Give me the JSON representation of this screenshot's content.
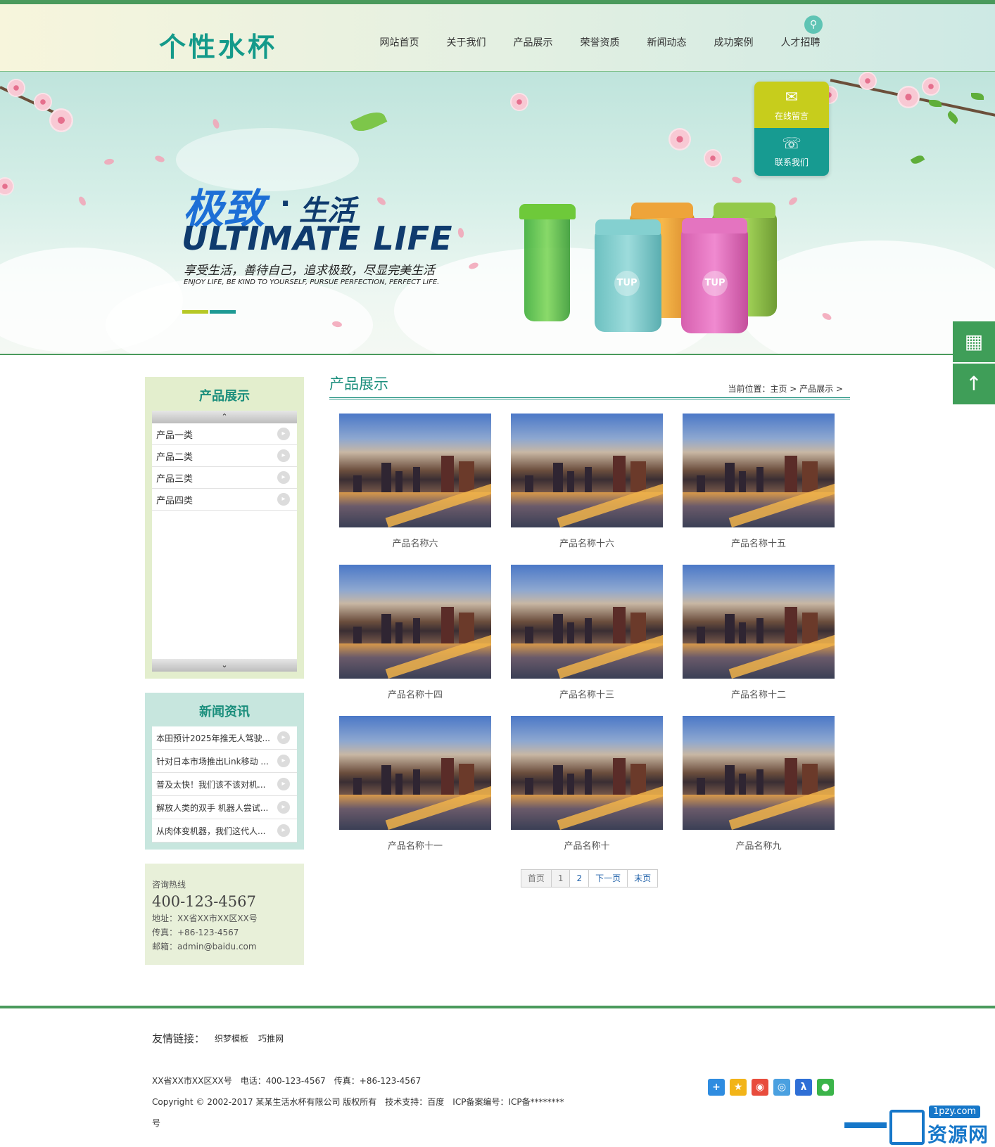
{
  "header": {
    "logo": "个性水杯",
    "nav": [
      "网站首页",
      "关于我们",
      "产品展示",
      "荣誉资质",
      "新闻动态",
      "成功案例",
      "人才招聘"
    ],
    "search_icon": "search-icon"
  },
  "banner": {
    "title_cn_1": "极致",
    "title_dot": "·",
    "title_cn_2": "生活",
    "title_en": "ULTIMATE  LIFE",
    "subtitle_cn": "享受生活，善待自己，追求极致，尽显完美生活",
    "subtitle_en": "ENJOY LIFE, BE KIND TO YOURSELF, PURSUE PERFECTION, PERFECT LIFE.",
    "cup_brand": "TUP"
  },
  "float_card": {
    "message_label": "在线留言",
    "contact_label": "联系我们"
  },
  "side_tools": {
    "qr_icon": "qr-code-icon",
    "top_icon": "back-to-top-icon"
  },
  "sidebar": {
    "product_title": "产品展示",
    "categories": [
      "产品一类",
      "产品二类",
      "产品三类",
      "产品四类"
    ],
    "news_title": "新闻资讯",
    "news": [
      "本田预计2025年推无人驾驶...",
      "针对日本市场推出Link移动 ...",
      "普及太快！我们该不该对机...",
      "解放人类的双手 机器人尝试...",
      "从肉体变机器，我们这代人..."
    ],
    "contact": {
      "hotline_label": "咨询热线",
      "hotline": "400-123-4567",
      "address": "地址：XX省XX市XX区XX号",
      "fax": "传真：+86-123-4567",
      "email": "邮箱：admin@baidu.com"
    }
  },
  "main": {
    "title": "产品展示",
    "breadcrumb": "当前位置：主页 > 产品展示 >",
    "products": [
      "产品名称六",
      "产品名称十六",
      "产品名称十五",
      "产品名称十四",
      "产品名称十三",
      "产品名称十二",
      "产品名称十一",
      "产品名称十",
      "产品名称九"
    ],
    "pager": {
      "first": "首页",
      "p1": "1",
      "p2": "2",
      "next": "下一页",
      "last": "末页"
    }
  },
  "footer": {
    "links_label": "友情链接：",
    "links": [
      "织梦模板",
      "巧推网"
    ],
    "line1": "XX省XX市XX区XX号　电话：400-123-4567　传真：+86-123-4567",
    "line2": "Copyright © 2002-2017 某某生活水杯有限公司 版权所有　技术支持：百度　ICP备案编号：ICP备********",
    "line3": "号",
    "share_icons": [
      "share-more-icon",
      "qzone-icon",
      "weibo-icon",
      "tencent-weibo-icon",
      "renren-icon",
      "wechat-icon"
    ]
  },
  "watermark": {
    "url": "1pzy.com",
    "text": "资源网"
  },
  "colors": {
    "accent": "#1a8e7c",
    "green": "#4a9a5c",
    "lime": "#c7cd1c",
    "teal": "#179b91"
  }
}
